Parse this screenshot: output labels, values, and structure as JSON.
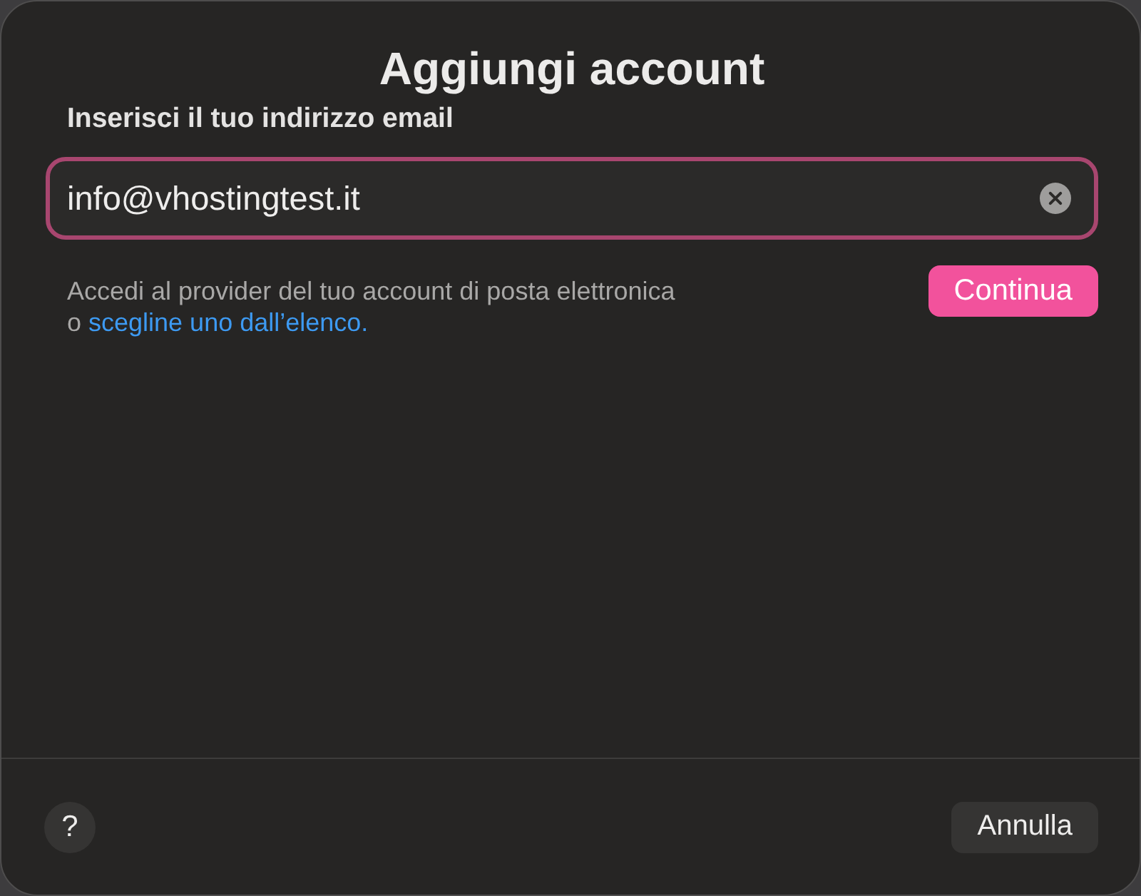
{
  "dialog": {
    "title": "Aggiungi account",
    "prompt": "Inserisci il tuo indirizzo email",
    "email_field": {
      "value": "info@vhostingtest.it",
      "focused": true
    },
    "description": {
      "text": "Accedi al provider del tuo account di posta elettronica",
      "link_prefix": "o",
      "link": "scegline uno dall’elenco."
    },
    "continue_button": {
      "label": "Continua"
    },
    "help_button": {
      "label": "?"
    },
    "cancel_button": {
      "label": "Annulla"
    }
  }
}
